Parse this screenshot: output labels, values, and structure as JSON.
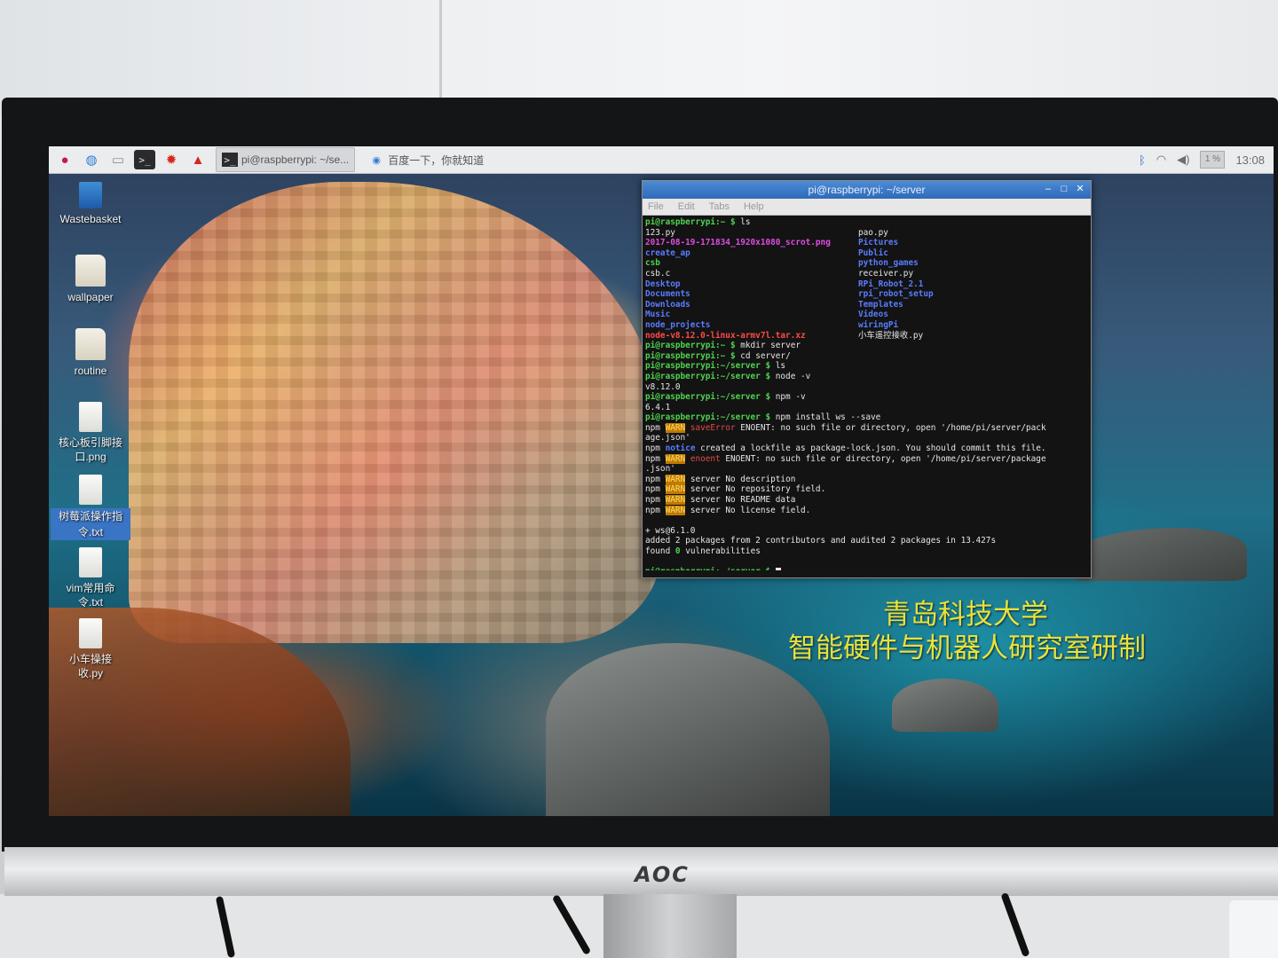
{
  "taskbar": {
    "tasks": [
      {
        "label": "pi@raspberrypi: ~/se..."
      },
      {
        "label": "百度一下，你就知道"
      }
    ],
    "clock": "13:08",
    "cpu": "1 %"
  },
  "desktop_icons": [
    {
      "label": "Wastebasket"
    },
    {
      "label": "wallpaper"
    },
    {
      "label": "routine"
    },
    {
      "label": "核心板引脚接口.png",
      "line1": "核心板引脚接",
      "line2": "口.png"
    },
    {
      "label": "树莓派操作指令.txt",
      "line1": "树莓派操作指",
      "line2": "令.txt"
    },
    {
      "label": "vim常用命令.txt",
      "line1": "vim常用命",
      "line2": "令.txt"
    },
    {
      "label": "小车操接收.py",
      "line1": "小车操接",
      "line2": "收.py"
    }
  ],
  "terminal": {
    "title": "pi@raspberrypi: ~/server",
    "menu": [
      "File",
      "Edit",
      "Tabs",
      "Help"
    ],
    "prompt_home": "pi@raspberrypi:~ $",
    "prompt_server": "pi@raspberrypi:~/server $",
    "ls_left": [
      "123.py",
      "2017-08-19-171834_1920x1080_scrot.png",
      "create_ap",
      "csb",
      "csb.c",
      "Desktop",
      "Documents",
      "Downloads",
      "Music",
      "node_projects",
      "node-v8.12.0-linux-armv7l.tar.xz"
    ],
    "ls_right": [
      "pao.py",
      "Pictures",
      "Public",
      "python_games",
      "receiver.py",
      "RPi_Robot_2.1",
      "rpi_robot_setup",
      "Templates",
      "Videos",
      "wiringPi",
      "小车遥控接收.py"
    ],
    "cmd_ls": "ls",
    "cmd_mkdir": "mkdir server",
    "cmd_cd": "cd server/",
    "cmd_ls2": "ls",
    "cmd_node": "node -v",
    "node_version": "v8.12.0",
    "cmd_npm": "npm -v",
    "npm_version": "6.4.1",
    "cmd_install": "npm install ws --save",
    "npm": "npm",
    "warn": "WARN",
    "notice": "notice",
    "saveError": "saveError",
    "enoent1": "ENOENT: no such file or directory, open '/home/pi/server/pack",
    "enoent1b": "age.json'",
    "lockfile": "created a lockfile as package-lock.json. You should commit this file.",
    "enoent_label": "enoent",
    "enoent2": "ENOENT: no such file or directory, open '/home/pi/server/package",
    "enoent2b": ".json'",
    "w1": "server No description",
    "w2": "server No repository field.",
    "w3": "server No README data",
    "w4": "server No license field.",
    "ws": "+ ws@6.1.0",
    "added": "added 2 packages from 2 contributors and audited 2 packages in 13.427s",
    "found": "found",
    "zero": "0",
    "vulns": "vulnerabilities"
  },
  "wallpaper_caption": {
    "line1": "青岛科技大学",
    "line2": "智能硬件与机器人研究室研制"
  },
  "monitor_brand": "AOC"
}
